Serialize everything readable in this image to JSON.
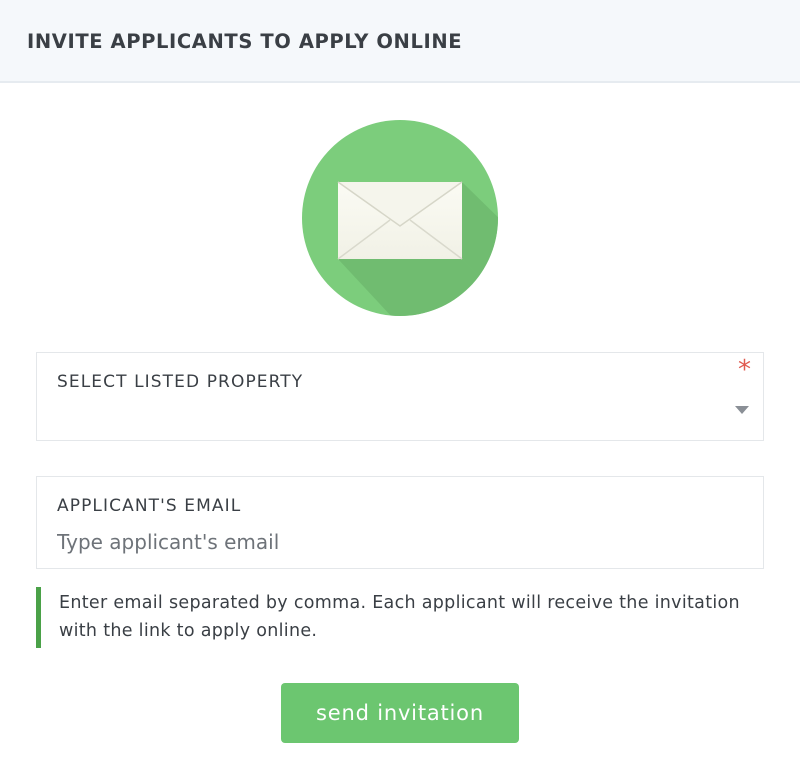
{
  "header": {
    "title": "INVITE APPLICANTS TO APPLY ONLINE"
  },
  "colors": {
    "accent_green": "#6cc670",
    "circle_green": "#7ccd7c",
    "hint_border_green": "#4aa148",
    "required_red": "#e05a4f",
    "header_bg": "#f5f8fb"
  },
  "hero": {
    "icon": "envelope-icon"
  },
  "property_field": {
    "label": "SELECT LISTED PROPERTY",
    "required_marker": "*",
    "selected_value": "",
    "caret_icon": "caret-down-icon"
  },
  "email_field": {
    "label": "APPLICANT'S EMAIL",
    "value": "",
    "placeholder": "Type applicant's email"
  },
  "hint": {
    "text": "Enter email separated by comma. Each applicant will receive the invitation with the link to apply online."
  },
  "actions": {
    "send_label": "send invitation"
  }
}
